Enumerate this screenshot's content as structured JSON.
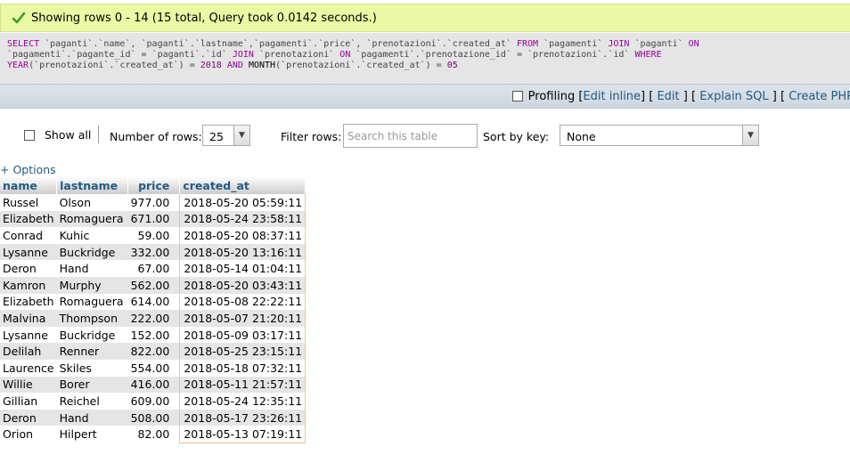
{
  "status": {
    "message": "Showing rows 0 - 14 (15 total, Query took 0.0142 seconds.)",
    "icon": "check-icon",
    "color": "#ebf8a4"
  },
  "sql": {
    "lines": [
      [
        {
          "t": "SELECT",
          "c": "kw"
        },
        {
          "t": " `paganti`.`name`, `paganti`.`lastname`,`pagamenti`.`price`, `prenotazioni`.`created_at` ",
          "c": "ident"
        },
        {
          "t": "FROM",
          "c": "kw"
        },
        {
          "t": " `pagamenti` ",
          "c": "ident"
        },
        {
          "t": "JOIN",
          "c": "kw"
        },
        {
          "t": " `paganti` ",
          "c": "ident"
        },
        {
          "t": "ON",
          "c": "kw"
        }
      ],
      [
        {
          "t": "`pagamenti`.`pagante_id` = `paganti`.`id` ",
          "c": "ident"
        },
        {
          "t": "JOIN",
          "c": "kw"
        },
        {
          "t": " `prenotazioni` ",
          "c": "ident"
        },
        {
          "t": "ON",
          "c": "kw"
        },
        {
          "t": " `pagamenti`.`prenotazione_id` = `prenotazioni`.`id` ",
          "c": "ident"
        },
        {
          "t": "WHERE",
          "c": "kw"
        }
      ],
      [
        {
          "t": "YEAR",
          "c": "kw"
        },
        {
          "t": "(`prenotazioni`.`created_at`) = ",
          "c": "ident"
        },
        {
          "t": "2018",
          "c": "num"
        },
        {
          "t": " AND ",
          "c": "kw"
        },
        {
          "t": "MONTH",
          "c": "fn"
        },
        {
          "t": "(`prenotazioni`.`created_at`) = ",
          "c": "ident"
        },
        {
          "t": "05",
          "c": "num"
        }
      ]
    ]
  },
  "toolbar": {
    "profiling_label": "Profiling",
    "edit_inline": "Edit inline",
    "edit": "Edit",
    "explain_sql": "Explain SQL",
    "create_php": "Create PHP"
  },
  "controls": {
    "show_all_label": "Show all",
    "rows_label": "Number of rows:",
    "rows_value": "25",
    "filter_label": "Filter rows:",
    "filter_placeholder": "Search this table",
    "sort_label": "Sort by key:",
    "sort_value": "None"
  },
  "options_link": "+ Options",
  "table": {
    "columns": [
      "name",
      "lastname",
      "price",
      "created_at"
    ],
    "rows": [
      [
        "Russel",
        "Olson",
        "977.00",
        "2018-05-20 05:59:11"
      ],
      [
        "Elizabeth",
        "Romaguera",
        "671.00",
        "2018-05-24 23:58:11"
      ],
      [
        "Conrad",
        "Kuhic",
        "59.00",
        "2018-05-20 08:37:11"
      ],
      [
        "Lysanne",
        "Buckridge",
        "332.00",
        "2018-05-20 13:16:11"
      ],
      [
        "Deron",
        "Hand",
        "67.00",
        "2018-05-14 01:04:11"
      ],
      [
        "Kamron",
        "Murphy",
        "562.00",
        "2018-05-20 03:43:11"
      ],
      [
        "Elizabeth",
        "Romaguera",
        "614.00",
        "2018-05-08 22:22:11"
      ],
      [
        "Malvina",
        "Thompson",
        "222.00",
        "2018-05-07 21:20:11"
      ],
      [
        "Lysanne",
        "Buckridge",
        "152.00",
        "2018-05-09 03:17:11"
      ],
      [
        "Delilah",
        "Renner",
        "822.00",
        "2018-05-25 23:15:11"
      ],
      [
        "Laurence",
        "Skiles",
        "554.00",
        "2018-05-18 07:32:11"
      ],
      [
        "Willie",
        "Borer",
        "416.00",
        "2018-05-11 21:57:11"
      ],
      [
        "Gillian",
        "Reichel",
        "609.00",
        "2018-05-24 12:35:11"
      ],
      [
        "Deron",
        "Hand",
        "508.00",
        "2018-05-17 23:26:11"
      ],
      [
        "Orion",
        "Hilpert",
        "82.00",
        "2018-05-13 07:19:11"
      ]
    ]
  }
}
